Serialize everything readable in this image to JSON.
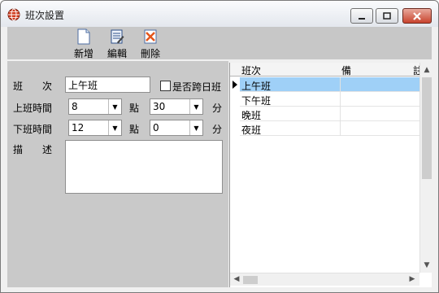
{
  "window": {
    "title": "班次設置"
  },
  "toolbar": {
    "buttons": [
      {
        "label": "新增",
        "icon": "new-document-icon"
      },
      {
        "label": "編輯",
        "icon": "edit-list-icon"
      },
      {
        "label": "刪除",
        "icon": "delete-icon"
      }
    ]
  },
  "form": {
    "shift_label": "班　　次",
    "shift_value": "上午班",
    "cross_day_label": "是否跨日班",
    "start_label": "上班時間",
    "start_hour": "8",
    "start_minute": "30",
    "end_label": "下班時間",
    "end_hour": "12",
    "end_minute": "0",
    "hour_unit": "點",
    "minute_unit": "分",
    "desc_label": "描　　述",
    "desc_value": ""
  },
  "grid": {
    "columns": [
      "班次",
      "備",
      "註"
    ],
    "rows": [
      {
        "name": "上午班",
        "note": ""
      },
      {
        "name": "下午班",
        "note": ""
      },
      {
        "name": "晚班",
        "note": ""
      },
      {
        "name": "夜班",
        "note": ""
      }
    ],
    "selected_index": 0
  },
  "colors": {
    "selection": "#9fd0f7",
    "close_button": "#c8432d",
    "panel": "#c9c9c9"
  }
}
